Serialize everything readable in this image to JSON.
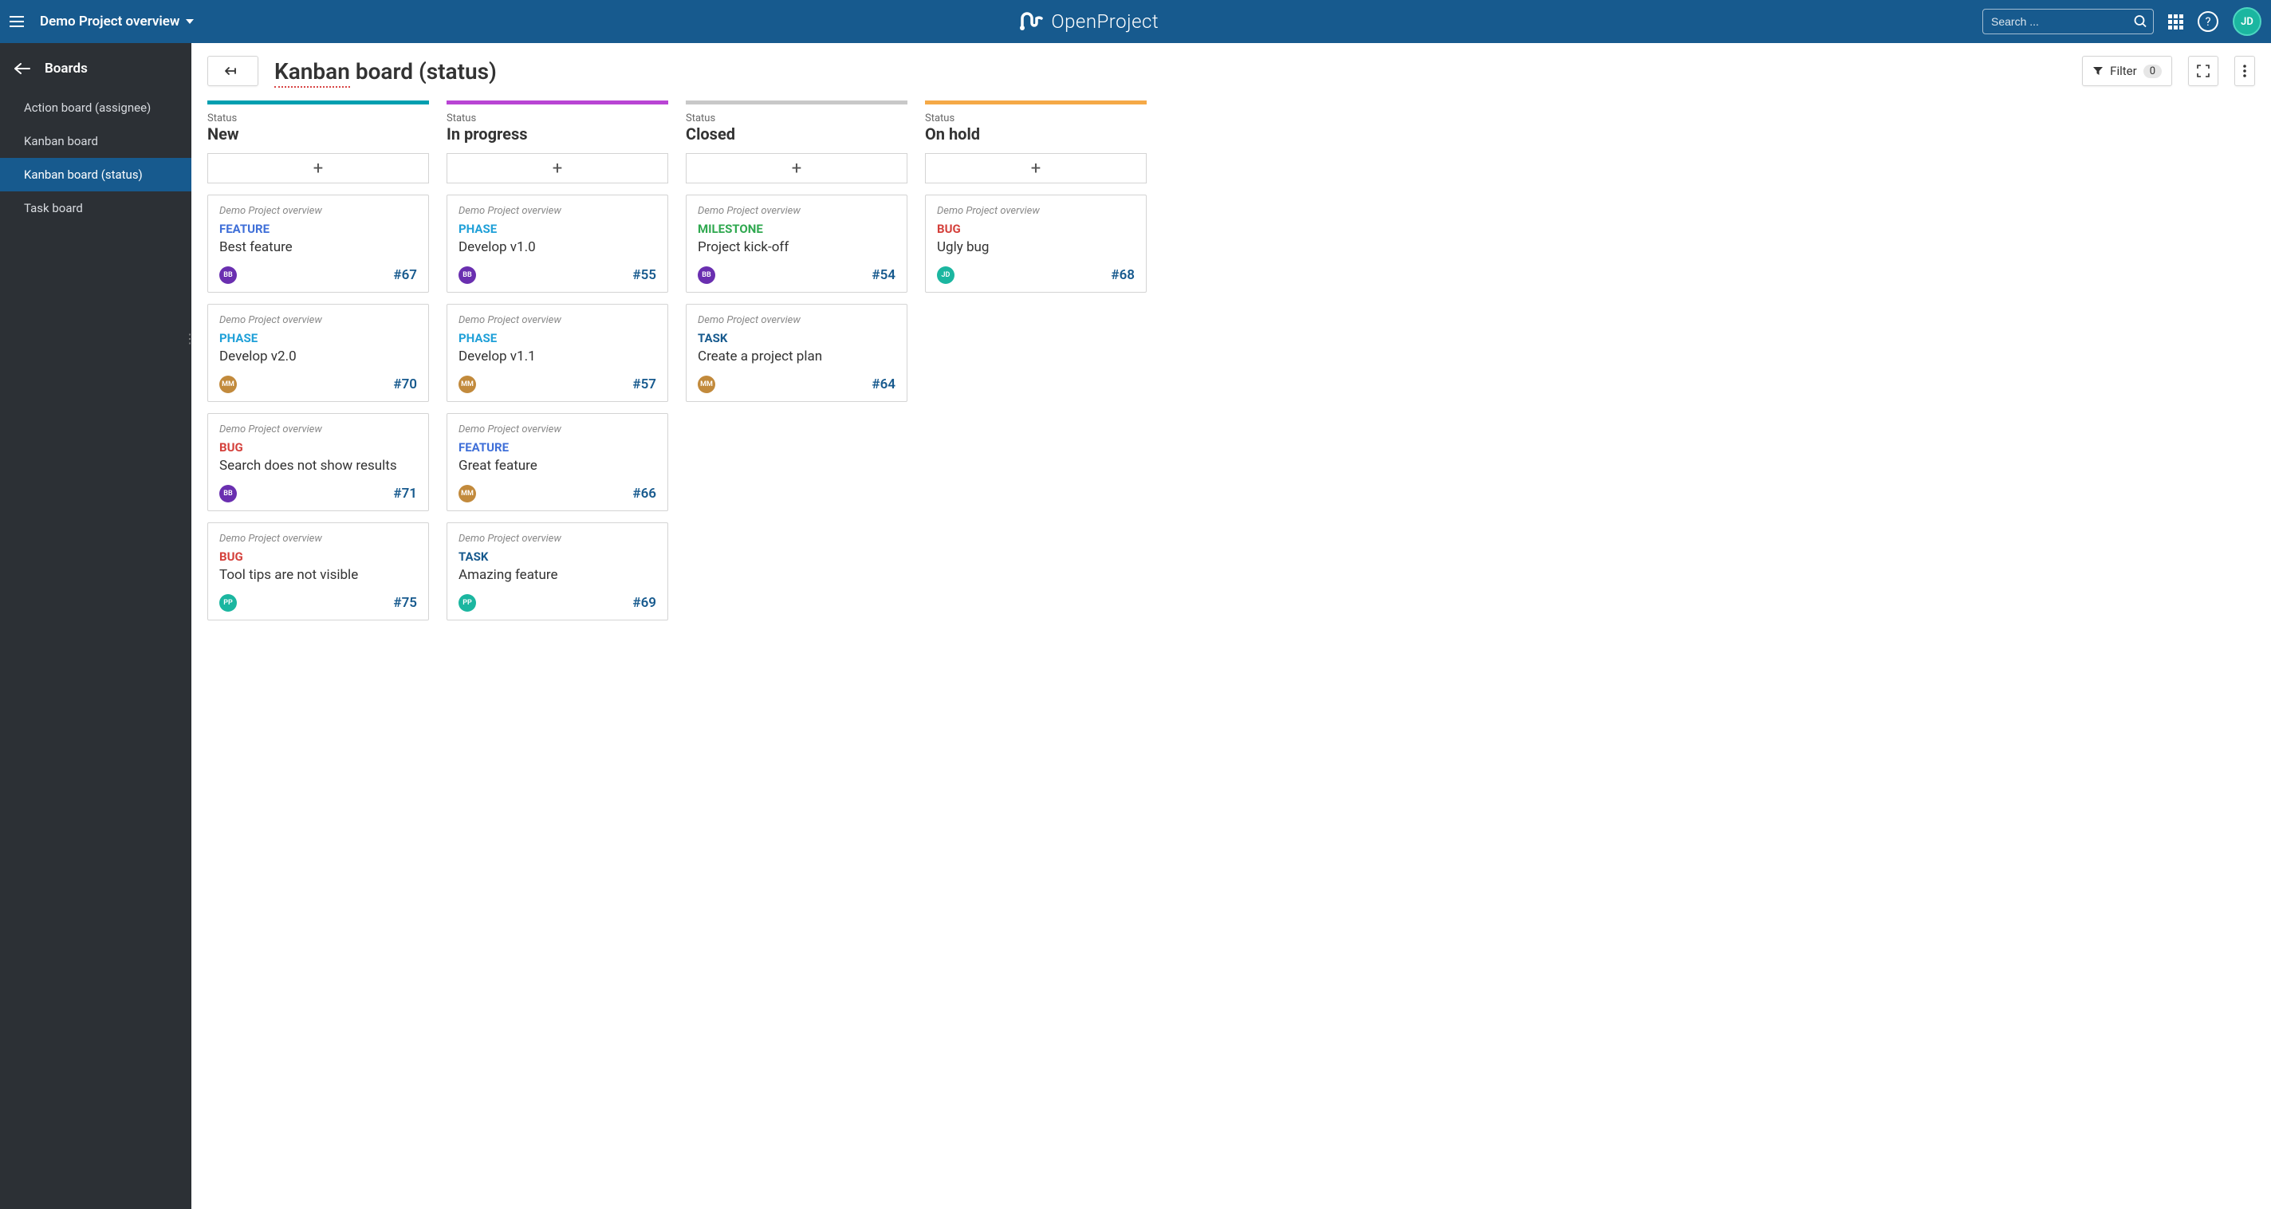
{
  "header": {
    "project": "Demo Project overview",
    "logoText": "OpenProject",
    "searchPlaceholder": "Search ...",
    "userInitials": "JD"
  },
  "sidebar": {
    "title": "Boards",
    "items": [
      {
        "label": "Action board (assignee)",
        "active": false
      },
      {
        "label": "Kanban board",
        "active": false
      },
      {
        "label": "Kanban board (status)",
        "active": true
      },
      {
        "label": "Task board",
        "active": false
      }
    ]
  },
  "toolbar": {
    "titleUnderlined": "Kanban",
    "titleRest": " board (status)",
    "filterLabel": "Filter",
    "filterCount": "0"
  },
  "typeColors": {
    "FEATURE": "#3f6fd8",
    "PHASE": "#1fa0d8",
    "BUG": "#d43f3a",
    "MILESTONE": "#2fa84f",
    "TASK": "#175a8e"
  },
  "avatarColors": {
    "BB": "#6a2fb0",
    "MM": "#c28a3c",
    "PP": "#1bb6a0",
    "JD": "#1bb6a0"
  },
  "columns": [
    {
      "label": "Status",
      "title": "New",
      "barColor": "#009fb0",
      "cards": [
        {
          "project": "Demo Project overview",
          "type": "FEATURE",
          "subject": "Best feature",
          "assignee": "BB",
          "id": "#67"
        },
        {
          "project": "Demo Project overview",
          "type": "PHASE",
          "subject": "Develop v2.0",
          "assignee": "MM",
          "id": "#70"
        },
        {
          "project": "Demo Project overview",
          "type": "BUG",
          "subject": "Search does not show results",
          "assignee": "BB",
          "id": "#71"
        },
        {
          "project": "Demo Project overview",
          "type": "BUG",
          "subject": "Tool tips are not visible",
          "assignee": "PP",
          "id": "#75"
        }
      ]
    },
    {
      "label": "Status",
      "title": "In progress",
      "barColor": "#b945d4",
      "cards": [
        {
          "project": "Demo Project overview",
          "type": "PHASE",
          "subject": "Develop v1.0",
          "assignee": "BB",
          "id": "#55"
        },
        {
          "project": "Demo Project overview",
          "type": "PHASE",
          "subject": "Develop v1.1",
          "assignee": "MM",
          "id": "#57"
        },
        {
          "project": "Demo Project overview",
          "type": "FEATURE",
          "subject": "Great feature",
          "assignee": "MM",
          "id": "#66"
        },
        {
          "project": "Demo Project overview",
          "type": "TASK",
          "subject": "Amazing feature",
          "assignee": "PP",
          "id": "#69"
        }
      ]
    },
    {
      "label": "Status",
      "title": "Closed",
      "barColor": "#c8c8c8",
      "cards": [
        {
          "project": "Demo Project overview",
          "type": "MILESTONE",
          "subject": "Project kick-off",
          "assignee": "BB",
          "id": "#54"
        },
        {
          "project": "Demo Project overview",
          "type": "TASK",
          "subject": "Create a project plan",
          "assignee": "MM",
          "id": "#64"
        }
      ]
    },
    {
      "label": "Status",
      "title": "On hold",
      "barColor": "#f5a947",
      "cards": [
        {
          "project": "Demo Project overview",
          "type": "BUG",
          "subject": "Ugly bug",
          "assignee": "JD",
          "id": "#68"
        }
      ]
    }
  ]
}
